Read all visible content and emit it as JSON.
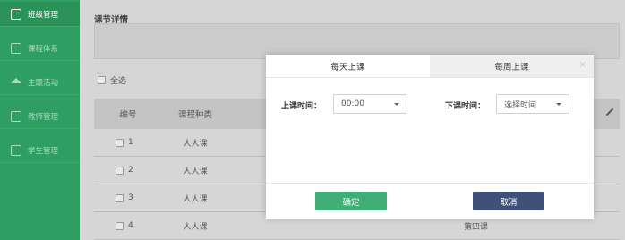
{
  "sidebar": {
    "items": [
      {
        "label": "班级管理",
        "icon": "calendar-icon"
      },
      {
        "label": "课程体系",
        "icon": "book-icon"
      },
      {
        "label": "主题活动",
        "icon": "home-icon"
      },
      {
        "label": "教师管理",
        "icon": "teacher-icon"
      },
      {
        "label": "学生管理",
        "icon": "student-icon"
      }
    ]
  },
  "main": {
    "section_title": "课节详情",
    "select_all_label": "全选",
    "table": {
      "headers": {
        "num": "编号",
        "type": "课程种类"
      },
      "rows": [
        {
          "num": "1",
          "type": "人人课",
          "name": ""
        },
        {
          "num": "2",
          "type": "人人课",
          "name": ""
        },
        {
          "num": "3",
          "type": "人人课",
          "name": ""
        },
        {
          "num": "4",
          "type": "人人课",
          "name": "第四课"
        }
      ]
    }
  },
  "modal": {
    "tabs": [
      {
        "label": "每天上课",
        "active": true
      },
      {
        "label": "每周上课",
        "active": false
      }
    ],
    "close": "×",
    "start_label": "上课时间：",
    "start_value": "00:00",
    "end_label": "下课时间：",
    "end_value": "选择时间",
    "ok_label": "确定",
    "cancel_label": "取消"
  },
  "colors": {
    "sidebar": "#2f9e62",
    "ok_button": "#3fae77",
    "cancel_button": "#3f5179"
  }
}
